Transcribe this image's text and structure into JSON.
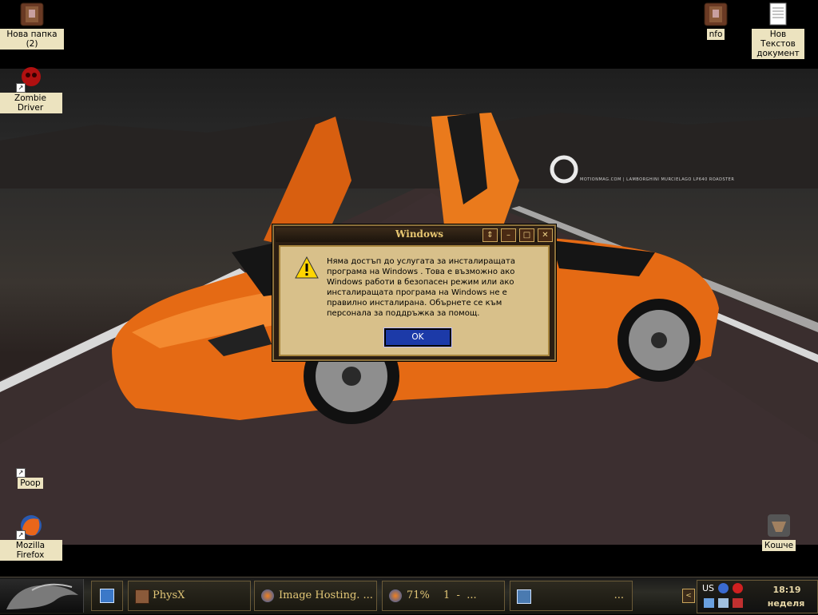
{
  "desktop": {
    "icons": [
      {
        "label": "Нова папка (2)",
        "icon": "folder-icon"
      },
      {
        "label": "Zombie Driver",
        "icon": "zombie-skull-icon"
      },
      {
        "label": "Poop",
        "icon": "shortcut-icon"
      },
      {
        "label": "Mozilla Firefox",
        "icon": "firefox-icon"
      },
      {
        "label": "nfo",
        "icon": "folder-icon"
      },
      {
        "label": "Нов Текстов документ",
        "icon": "text-document-icon"
      },
      {
        "label": "Кошче",
        "icon": "recycle-bin-icon"
      }
    ],
    "wallpaper_text": "MOTIONMAG.COM | LAMBORGHINI MURCIELAGO LP640 ROADSTER"
  },
  "dialog": {
    "title": "Windows",
    "message": "Няма достъп до услугата за инсталиращата програма на Windows . Това е възможно ако Windows работи в безопасен режим или ако инсталиращата програма на Windows не е правилно инсталирана. Обърнете се към персонала за поддръжка за помощ.",
    "ok_label": "OK",
    "icon": "warning-icon"
  },
  "taskbar": {
    "items": [
      {
        "label": "PhysX",
        "icon": "physx-app-icon"
      },
      {
        "label": "Image Hosting. ...",
        "icon": "firefox-icon"
      },
      {
        "label": "71%",
        "extra": "1  -  ...",
        "icon": "firefox-icon"
      },
      {
        "label": "...",
        "icon": "network-icon"
      }
    ],
    "tray": {
      "language": "US",
      "time": "18:19",
      "day": "неделя"
    }
  },
  "colors": {
    "dialog_bg": "#d8c08a",
    "dialog_title_text": "#e7c671",
    "ok_button": "#1c3aa8",
    "taskbar_text": "#e3c777"
  }
}
